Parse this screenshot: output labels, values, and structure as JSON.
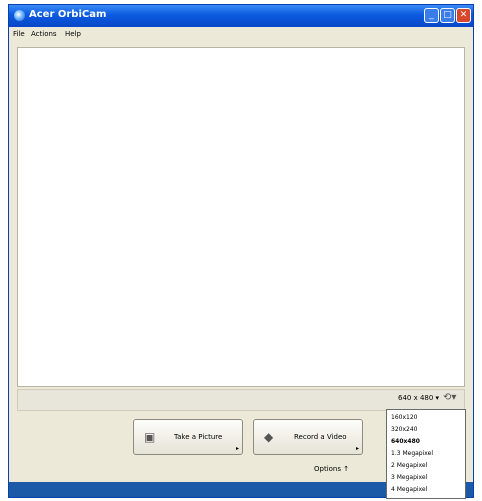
{
  "window": {
    "title": "Acer OrbiCam",
    "buttons": {
      "minimize": "_",
      "maximize": "□",
      "close": "✕"
    }
  },
  "menubar": {
    "items": [
      "File",
      "Actions",
      "Help"
    ]
  },
  "statusbar": {
    "resolution": "640 x 480 ▾",
    "camera_menu": "▾"
  },
  "controls": {
    "take_picture": {
      "label": "Take a Picture"
    },
    "record_video": {
      "label": "Record a Video"
    },
    "options": "Options ↑"
  },
  "resolution_dropdown": {
    "options": [
      "160x120",
      "320x240",
      "640x480",
      "1.3 Megapixel",
      "2 Megapixel",
      "3 Megapixel",
      "4 Megapixel"
    ],
    "selected": "640x480"
  },
  "colors": {
    "titlebar": "#0b5ae0",
    "window_bg": "#ece9d8",
    "close": "#d8462b"
  }
}
